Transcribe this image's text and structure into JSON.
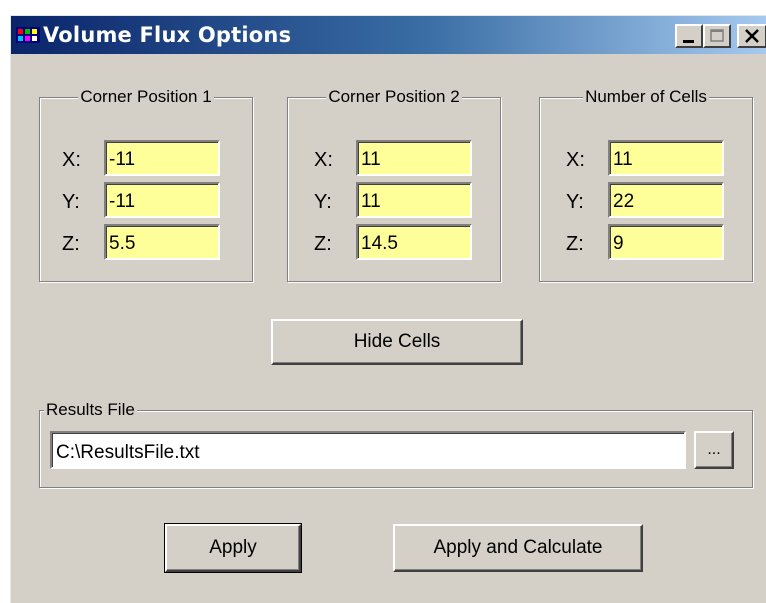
{
  "window": {
    "title": "Volume Flux Options",
    "controls": {
      "minimize": "_",
      "maximize": "□",
      "close": "X"
    }
  },
  "groups": {
    "corner1": {
      "label": "Corner Position 1",
      "x_label": "X:",
      "x_value": "-11",
      "y_label": "Y:",
      "y_value": "-11",
      "z_label": "Z:",
      "z_value": "5.5"
    },
    "corner2": {
      "label": "Corner Position 2",
      "x_label": "X:",
      "x_value": "11",
      "y_label": "Y:",
      "y_value": "11",
      "z_label": "Z:",
      "z_value": "14.5"
    },
    "cells": {
      "label": "Number of Cells",
      "x_label": "X:",
      "x_value": "11",
      "y_label": "Y:",
      "y_value": "22",
      "z_label": "Z:",
      "z_value": "9"
    }
  },
  "hide_cells_label": "Hide Cells",
  "results": {
    "label": "Results File",
    "path": "C:\\ResultsFile.txt",
    "browse_label": "..."
  },
  "buttons": {
    "apply": "Apply",
    "apply_calculate": "Apply and Calculate"
  },
  "colors": {
    "field_background": "#ffff99",
    "dialog_background": "#d4d0c8",
    "titlebar_start": "#0a246a",
    "titlebar_end": "#a6caf0"
  },
  "icons": [
    "app-window-icon",
    "minimize-icon",
    "maximize-icon",
    "close-icon"
  ]
}
